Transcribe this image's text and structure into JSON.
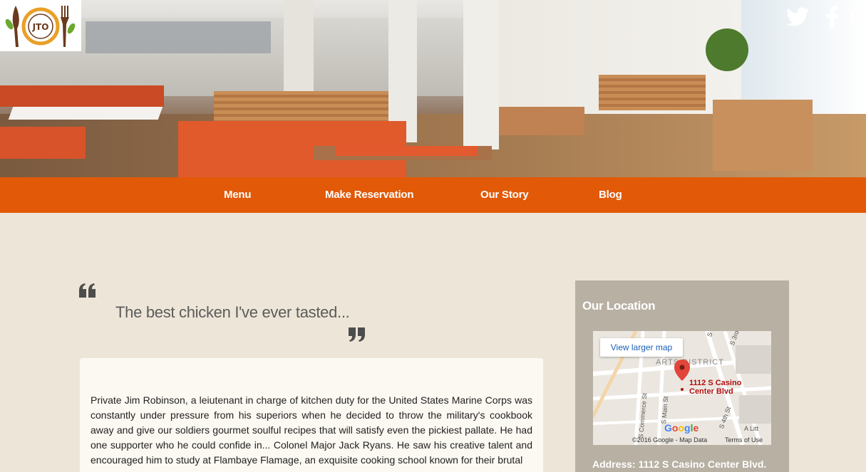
{
  "brand": {
    "logo_text": "JTO"
  },
  "nav": {
    "items": [
      {
        "label": "Menu"
      },
      {
        "label": "Make Reservation"
      },
      {
        "label": "Our Story"
      },
      {
        "label": "Blog"
      }
    ]
  },
  "quote": {
    "text": "The best chicken I've ever tasted..."
  },
  "story": {
    "text": "Private Jim Robinson, a leiutenant in charge of kitchen duty for the United States Marine Corps was constantly under pressure from his superiors when he decided to throw the military's cookbook away and give our soldiers gourmet soulful recipes that will satisfy even the pickiest pallate. He had one supporter who he could confide in... Colonel Major Jack Ryans. He saw his creative talent and encouraged him to study at Flambaye Flamage, an exquisite cooking school known for their brutal"
  },
  "location": {
    "title": "Our Location",
    "map": {
      "view_larger": "View larger map",
      "district": "ARTS DISTRICT",
      "marker_label": "1112 S Casino Center Blvd",
      "google": "Google",
      "attribution": "©2016 Google - Map Data",
      "terms": "Terms of Use",
      "streets": [
        "S Casino",
        "S 3rd St",
        "S Commerce St",
        "S Main St",
        "S 4th St",
        "A Litt"
      ]
    },
    "address": "Address: 1112 S Casino Center Blvd."
  },
  "colors": {
    "accent": "#e25908",
    "background": "#ede6d8",
    "sidebar": "#b7b0a3"
  }
}
